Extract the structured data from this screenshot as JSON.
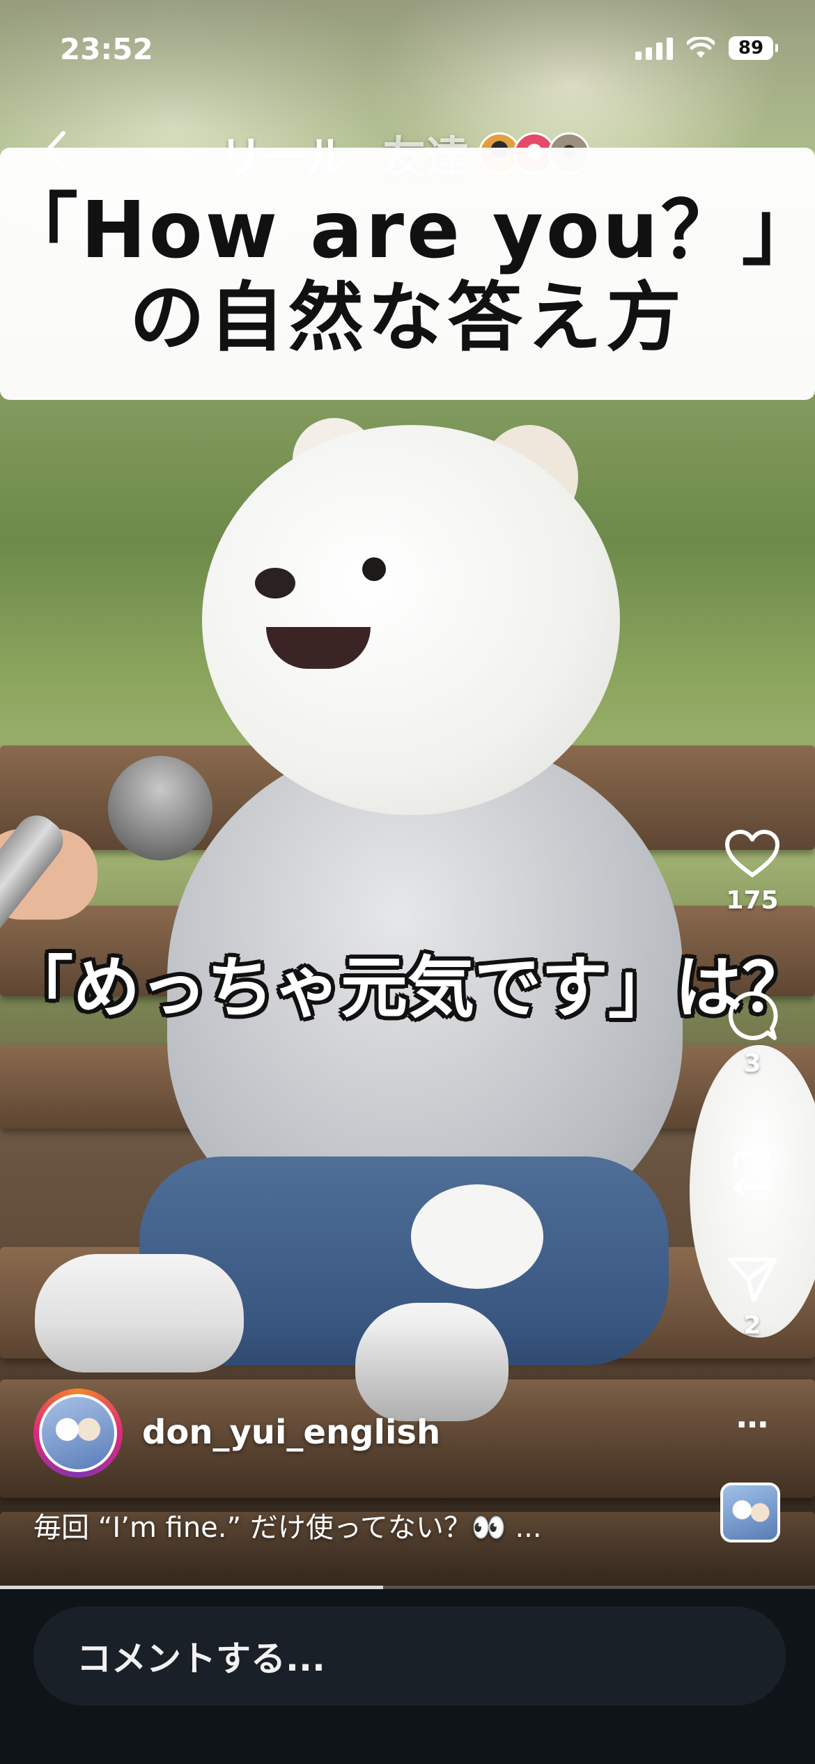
{
  "status_bar": {
    "time": "23:52",
    "battery": "89"
  },
  "nav": {
    "tabs": [
      {
        "label": "リール",
        "active": true
      },
      {
        "label": "友達",
        "active": false
      }
    ],
    "friend_avatar_colors": [
      "#e0a040",
      "#e64a6a",
      "#9b8f80"
    ]
  },
  "video": {
    "title_line1": "「How are you？」",
    "title_line2": "の自然な答え方",
    "caption_overlay": "「めっちゃ元気です」は？"
  },
  "actions": {
    "like_count": "175",
    "comment_count": "3",
    "repost_count": "",
    "share_count": "2",
    "more_label": "…"
  },
  "author": {
    "username": "don_yui_english"
  },
  "post": {
    "caption": "毎回 “I’m fine.” だけ使ってない？👀 ..."
  },
  "progress": 0.47,
  "comment": {
    "placeholder": "コメントする..."
  }
}
